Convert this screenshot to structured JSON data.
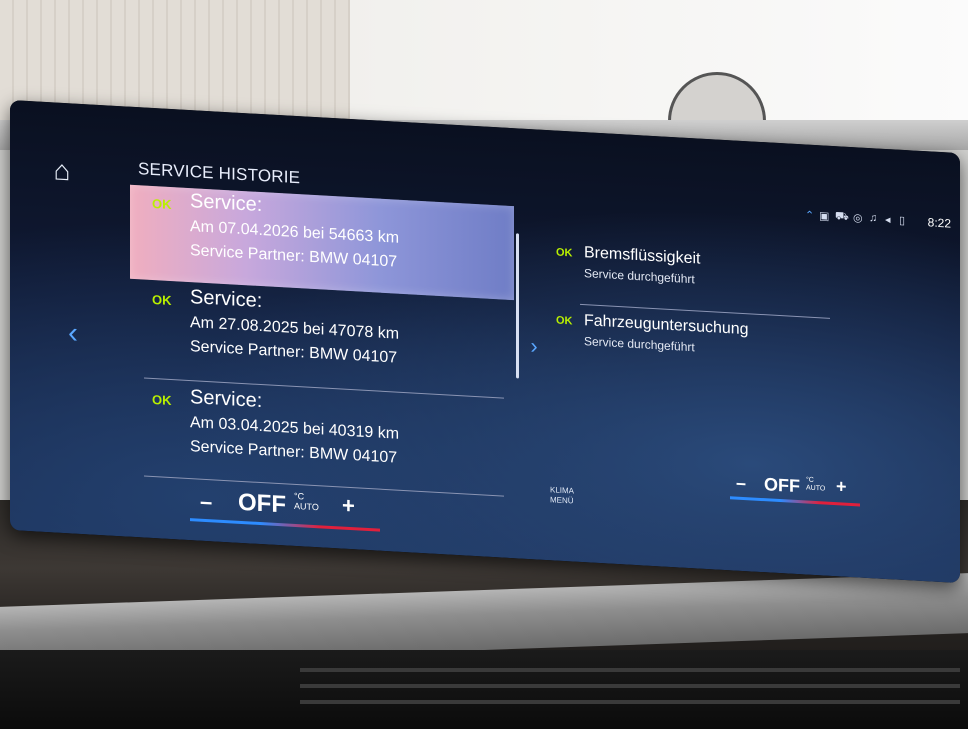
{
  "screen": {
    "title": "SERVICE HISTORIE",
    "icons": {
      "home": "home-icon",
      "left": "chevron-left-icon",
      "right": "chevron-right-icon"
    }
  },
  "list": {
    "items": [
      {
        "status": "OK",
        "title": "Service:",
        "line1": "Am 07.04.2026 bei 54663 km",
        "line2": "Service Partner: BMW 04107",
        "selected": true
      },
      {
        "status": "OK",
        "title": "Service:",
        "line1": "Am 27.08.2025 bei 47078 km",
        "line2": "Service Partner: BMW 04107",
        "selected": false
      },
      {
        "status": "OK",
        "title": "Service:",
        "line1": "Am 03.04.2025 bei 40319 km",
        "line2": "Service Partner: BMW 04107",
        "selected": false
      }
    ]
  },
  "detail": {
    "items": [
      {
        "status": "OK",
        "name": "Bremsflüssigkeit",
        "sub": "Service durchgeführt"
      },
      {
        "status": "OK",
        "name": "Fahrzeuguntersuchung",
        "sub": "Service durchgeführt"
      }
    ]
  },
  "status_bar": {
    "time": "8:22",
    "icons": [
      "arrow-up-icon",
      "badge-icon",
      "car-icon",
      "driver-assist-icon",
      "music-icon",
      "volume-icon",
      "phone-icon"
    ]
  },
  "climate": {
    "minus": "–",
    "value": "OFF",
    "unit_top": "°C",
    "unit_bottom": "AUTO",
    "plus": "+",
    "menu_line1": "KLIMA",
    "menu_line2": "MENÜ"
  },
  "colors": {
    "ok_green": "#b9f000",
    "accent_blue": "#5aa7ff",
    "cold_blue": "#2d8cff",
    "hot_red": "#e0203c",
    "selected_pink": "#f0aebf"
  }
}
